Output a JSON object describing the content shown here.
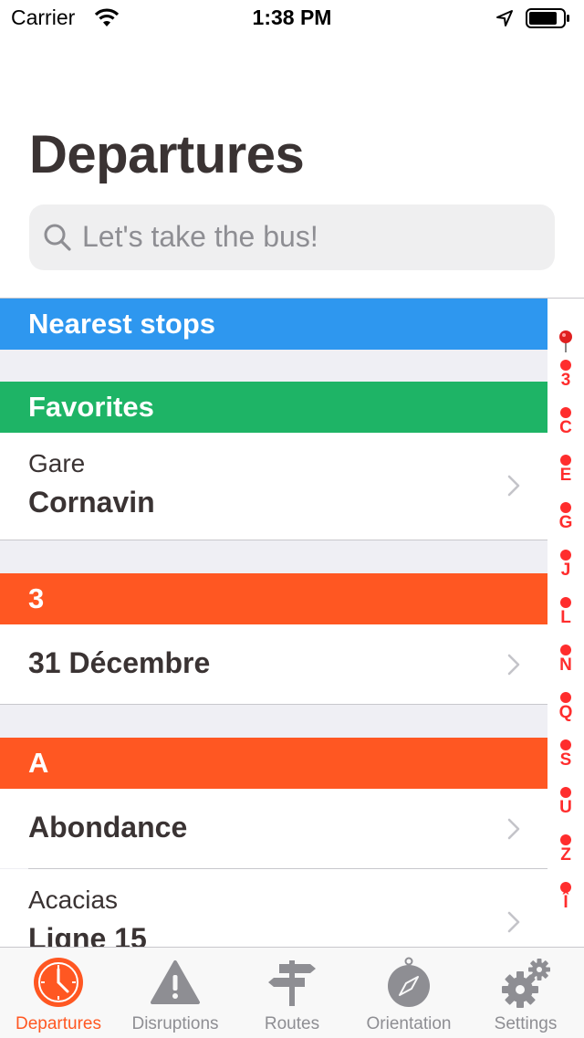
{
  "status_bar": {
    "carrier": "Carrier",
    "time": "1:38 PM"
  },
  "page_title": "Departures",
  "search": {
    "placeholder": "Let's take the bus!"
  },
  "sections": {
    "nearest": {
      "title": "Nearest stops",
      "color": "#2e97ef"
    },
    "favorites": {
      "title": "Favorites",
      "color": "#1eb466",
      "items": [
        {
          "sub": "Gare",
          "main": "Cornavin"
        }
      ]
    },
    "s3": {
      "title": "3",
      "color": "#ff5722",
      "items": [
        {
          "main": "31 Décembre"
        }
      ]
    },
    "sA": {
      "title": "A",
      "color": "#ff5722",
      "items": [
        {
          "main": "Abondance"
        },
        {
          "sub": "Acacias",
          "main": "Ligne 15"
        }
      ]
    }
  },
  "index": {
    "icon": "map-pin-icon",
    "letters": [
      "3",
      "C",
      "E",
      "G",
      "J",
      "L",
      "N",
      "Q",
      "S",
      "U",
      "Z",
      "Î"
    ],
    "color": "#ff2d2d"
  },
  "tabs": [
    {
      "label": "Departures",
      "icon": "clock-icon",
      "active": true
    },
    {
      "label": "Disruptions",
      "icon": "warning-icon",
      "active": false
    },
    {
      "label": "Routes",
      "icon": "signpost-icon",
      "active": false
    },
    {
      "label": "Orientation",
      "icon": "compass-icon",
      "active": false
    },
    {
      "label": "Settings",
      "icon": "gears-icon",
      "active": false
    }
  ],
  "colors": {
    "accent": "#ff5722",
    "inactive_tab": "#8e8e93"
  }
}
